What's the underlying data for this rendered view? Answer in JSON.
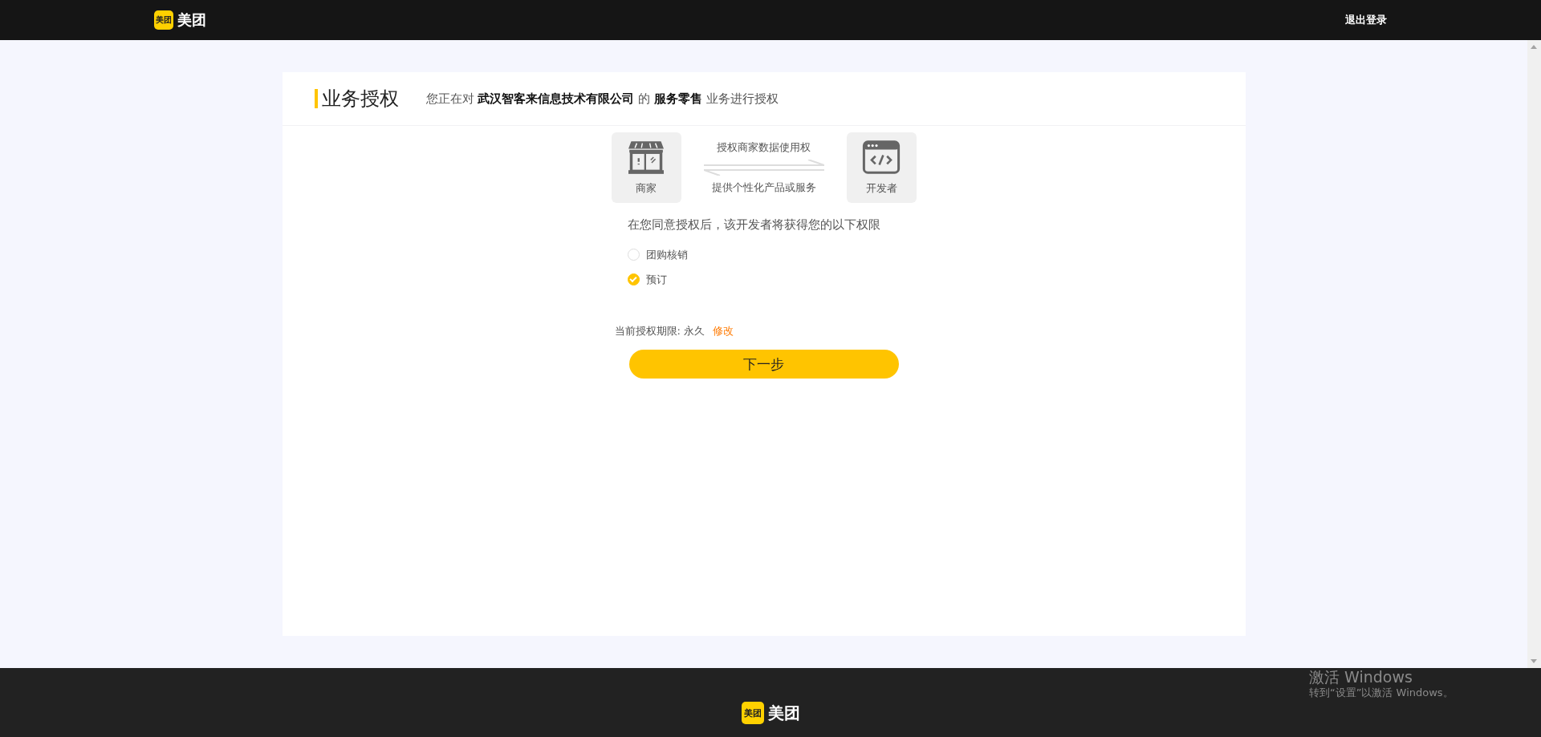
{
  "header": {
    "logo": {
      "badge": "美团",
      "name": "美团"
    },
    "logout": "退出登录"
  },
  "card": {
    "title": "业务授权",
    "subtitle": "您正在对 **武汉智客来信息技术有限公司** 的 **服务零售** 业务进行授权",
    "flow": {
      "left": "商家",
      "right": "开发者",
      "top_label": "授权商家数据使用权",
      "bottom_label": "提供个性化产品或服务"
    },
    "permissions_heading": "在您同意授权后，该开发者将获得您的以下权限",
    "permissions": [
      {
        "label": "团购核销",
        "checked": false
      },
      {
        "label": "预订",
        "checked": true
      }
    ],
    "period_label": "当前授权期限: 永久",
    "period_link": "修改",
    "next_button": "下一步"
  },
  "footer": {
    "logo": {
      "badge": "美团",
      "name": "美团"
    }
  },
  "os_notice": {
    "title": "激活 Windows",
    "text": "转到“设置”以激活 Windows。"
  }
}
